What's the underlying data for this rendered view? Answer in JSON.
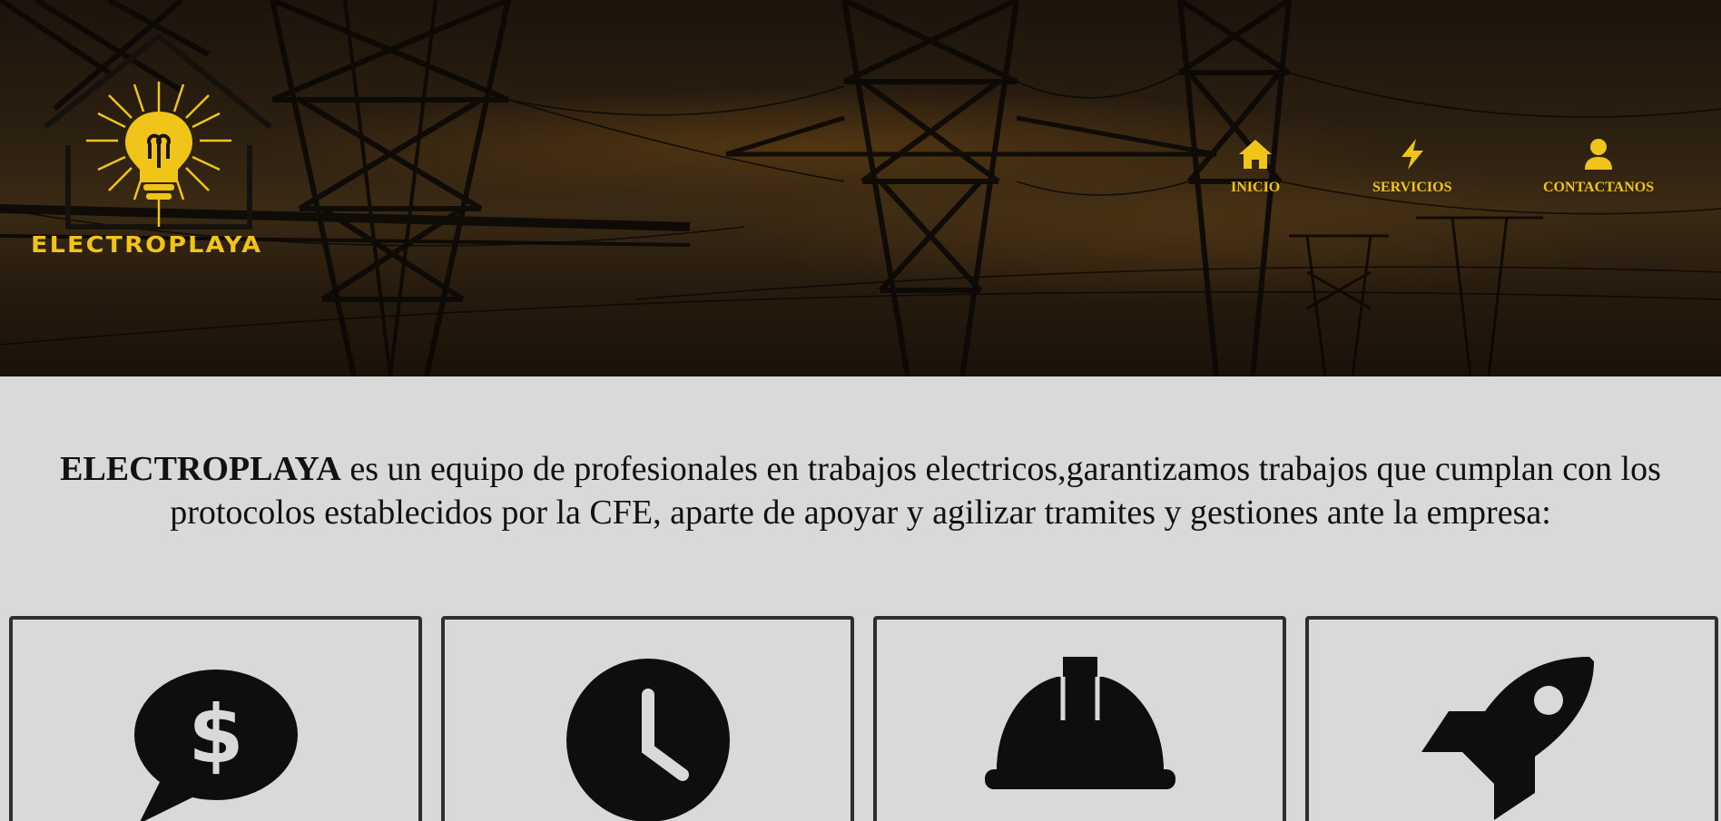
{
  "brand": {
    "name": "ELECTROPLAYA",
    "accent_color": "#f0c419"
  },
  "nav": {
    "items": [
      {
        "label": "INICIO",
        "icon": "home-icon"
      },
      {
        "label": "SERVICIOS",
        "icon": "lightning-bolt-icon"
      },
      {
        "label": "CONTACTANOS",
        "icon": "user-icon"
      }
    ]
  },
  "intro": {
    "brand": "ELECTROPLAYA",
    "text": " es un equipo de profesionales en trabajos electricos,garantizamos trabajos que cumplan con los protocolos establecidos por la CFE, aparte de apoyar y agilizar tramites y gestiones ante la empresa:"
  },
  "cards": [
    {
      "icon": "money-chat-icon"
    },
    {
      "icon": "clock-icon"
    },
    {
      "icon": "hard-hat-icon"
    },
    {
      "icon": "rocket-icon"
    }
  ]
}
